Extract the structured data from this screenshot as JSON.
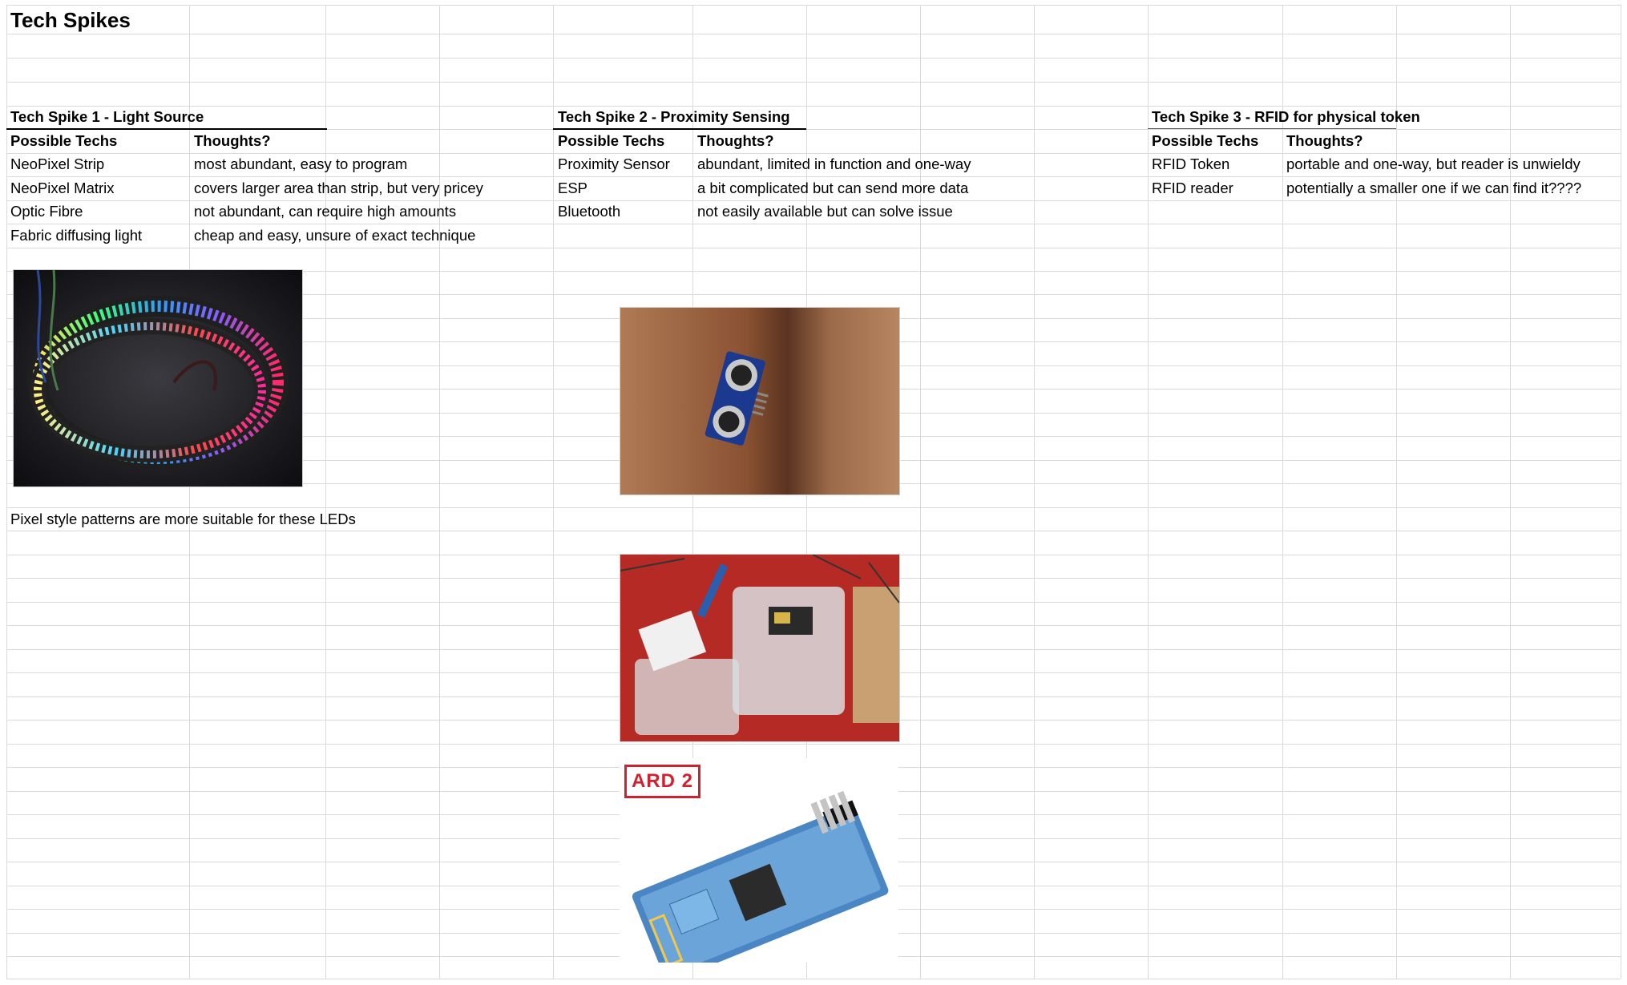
{
  "sheet": {
    "title": "Tech Spikes"
  },
  "spike1": {
    "heading": "Tech Spike 1 - Light Source",
    "col_techs": "Possible Techs",
    "col_thoughts": "Thoughts?",
    "rows": [
      {
        "tech": "NeoPixel Strip",
        "thought": "most abundant, easy to program"
      },
      {
        "tech": "NeoPixel Matrix",
        "thought": "covers larger area than strip, but very pricey"
      },
      {
        "tech": "Optic Fibre",
        "thought": "not abundant, can require high amounts"
      },
      {
        "tech": "Fabric diffusing light",
        "thought": "cheap and easy, unsure of exact technique"
      }
    ],
    "note": "Pixel style patterns are more suitable for these LEDs"
  },
  "spike2": {
    "heading": "Tech Spike 2 - Proximity Sensing",
    "col_techs": "Possible Techs",
    "col_thoughts": "Thoughts?",
    "rows": [
      {
        "tech": "Proximity Sensor",
        "thought": "abundant, limited in function and one-way"
      },
      {
        "tech": "ESP",
        "thought": "a bit complicated but can send more data"
      },
      {
        "tech": "Bluetooth",
        "thought": "not easily available but can solve issue"
      }
    ],
    "bluetooth_logo": "ARD 2"
  },
  "spike3": {
    "heading": "Tech Spike 3 - RFID for physical token",
    "col_techs": "Possible Techs",
    "col_thoughts": "Thoughts?",
    "rows": [
      {
        "tech": "RFID Token",
        "thought": "portable and one-way, but reader is unwieldy"
      },
      {
        "tech": "RFID reader",
        "thought": "potentially a smaller one if we can find it????"
      }
    ]
  },
  "images": {
    "neopixel": "neopixel-strip-photo",
    "ultrasonic": "ultrasonic-sensor-photo",
    "esp": "esp-boards-photo",
    "bluetooth": "bluetooth-module-photo"
  }
}
